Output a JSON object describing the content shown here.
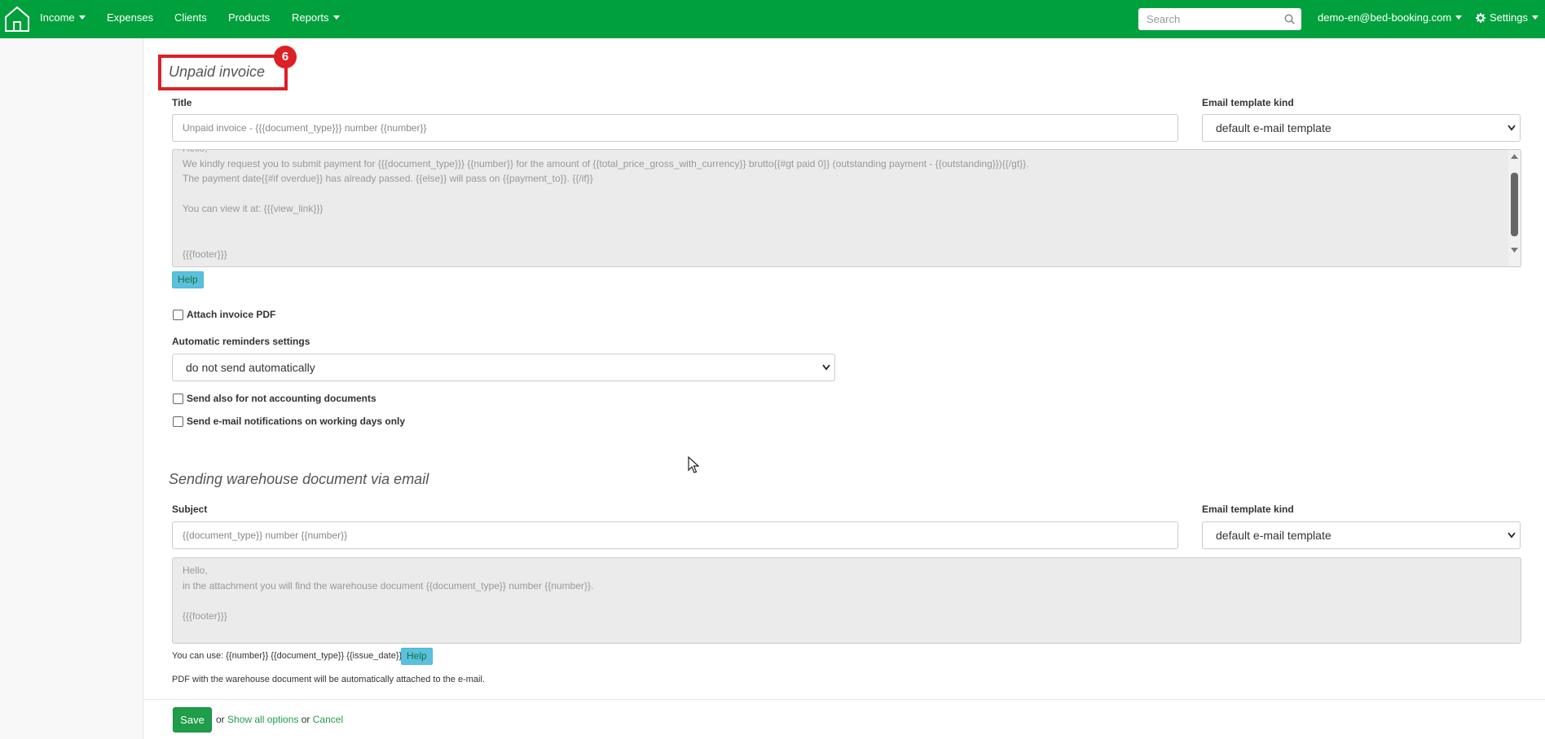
{
  "nav": {
    "items": [
      {
        "label": "Income",
        "has_caret": true
      },
      {
        "label": "Expenses",
        "has_caret": false
      },
      {
        "label": "Clients",
        "has_caret": false
      },
      {
        "label": "Products",
        "has_caret": false
      },
      {
        "label": "Reports",
        "has_caret": true
      }
    ],
    "search_placeholder": "Search",
    "account": "demo-en@bed-booking.com",
    "settings": "Settings"
  },
  "unpaid": {
    "section_title": "Unpaid invoice",
    "badge": "6",
    "title_label": "Title",
    "title_value": "Unpaid invoice - {{{document_type}}} number {{number}}",
    "template_kind_label": "Email template kind",
    "template_kind_value": "default e-mail template",
    "body_lines": [
      "Hello,",
      "We kindly request you to submit payment for {{{document_type}}} {{number}} for the amount of {{total_price_gross_with_currency}} brutto{{#gt paid 0}} (outstanding payment - {{outstanding}}){{/gt}}.",
      "The payment date{{#if overdue}} has already passed. {{else}} will pass on {{payment_to}}. {{/if}}",
      "",
      "You can view it at: {{{view_link}}}",
      "",
      "",
      "{{{footer}}}"
    ],
    "help": "Help",
    "attach_pdf": "Attach invoice PDF",
    "reminders_label": "Automatic reminders settings",
    "reminders_value": "do not send automatically",
    "send_not_accounting": "Send also for not accounting documents",
    "working_days_only": "Send e-mail notifications on working days only"
  },
  "warehouse": {
    "section_title": "Sending warehouse document via email",
    "subject_label": "Subject",
    "subject_value": "{{document_type}} number {{number}}",
    "template_kind_label": "Email template kind",
    "template_kind_value": "default e-mail template",
    "body_lines": [
      "Hello,",
      "in the attachment you will find the warehouse document {{document_type}} number {{number}}.",
      "",
      "{{{footer}}}"
    ],
    "can_use": "You can use: {{number}} {{document_type}} {{issue_date}}",
    "help": "Help",
    "pdf_note": "PDF with the warehouse document will be automatically attached to the e-mail."
  },
  "footer": {
    "save": "Save",
    "or1": "or",
    "show_all": "Show all options",
    "or2": "or",
    "cancel": "Cancel"
  },
  "colors": {
    "brand_green": "#00a03c",
    "highlight_red": "#dd1f26",
    "help_blue": "#5bc0de"
  }
}
